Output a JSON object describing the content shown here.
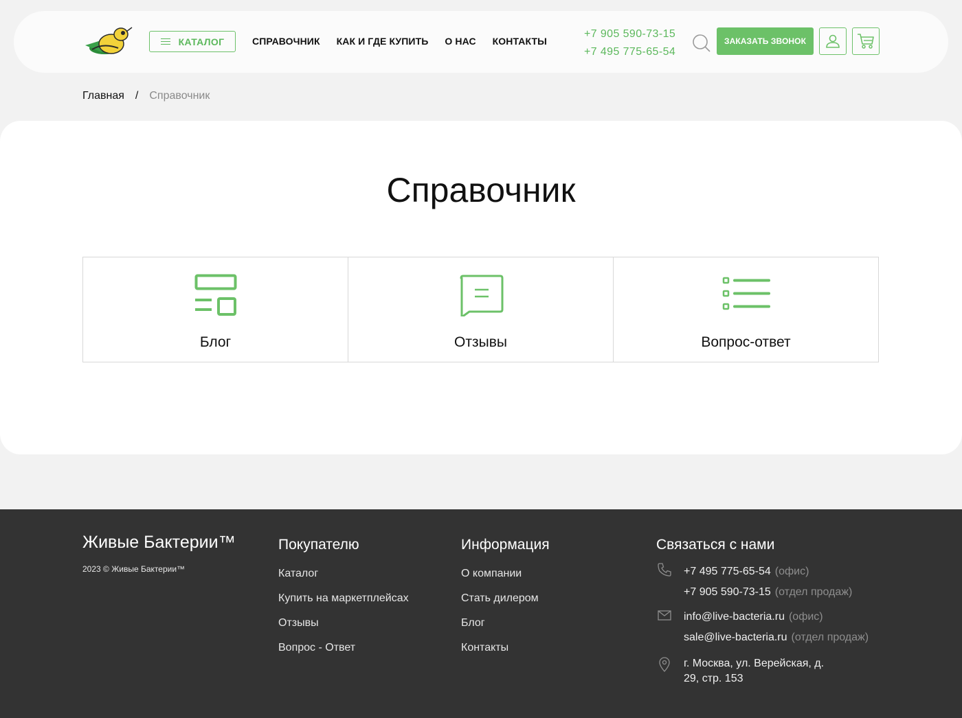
{
  "header": {
    "catalog_label": "КАТАЛОГ",
    "nav": [
      "СПРАВОЧНИК",
      "КАК И ГДЕ КУПИТЬ",
      "О НАС",
      "КОНТАКТЫ"
    ],
    "phones": [
      "+7 905 590-73-15",
      "+7 495 775-65-54"
    ],
    "order_call_label": "ЗАКАЗАТЬ ЗВОНОК",
    "icons": [
      "search-icon",
      "user-icon",
      "cart-icon"
    ],
    "accent_color": "#6cc168"
  },
  "breadcrumb": {
    "home": "Главная",
    "separator": "/",
    "current": "Справочник"
  },
  "main": {
    "title": "Справочник",
    "cards": [
      {
        "label": "Блог",
        "icon": "blog-layout-icon"
      },
      {
        "label": "Отзывы",
        "icon": "chat-bubble-icon"
      },
      {
        "label": "Вопрос-ответ",
        "icon": "list-icon"
      }
    ]
  },
  "footer": {
    "brand": "Живые Бактерии™",
    "copyright": "2023 © Живые Бактерии™",
    "buyer": {
      "heading": "Покупателю",
      "links": [
        "Каталог",
        "Купить на маркетплейсах",
        "Отзывы",
        "Вопрос - Ответ"
      ]
    },
    "info": {
      "heading": "Информация",
      "links": [
        "О компании",
        "Стать дилером",
        "Блог",
        "Контакты"
      ]
    },
    "contact": {
      "heading": "Связаться с нами",
      "phones": [
        {
          "value": "+7 495 775-65-54",
          "note": "(офис)"
        },
        {
          "value": "+7 905 590-73-15",
          "note": "(отдел продаж)"
        }
      ],
      "emails": [
        {
          "value": "info@live-bacteria.ru",
          "note": "(офис)"
        },
        {
          "value": "sale@live-bacteria.ru",
          "note": "(отдел продаж)"
        }
      ],
      "address": "г. Москва, ул. Верейская, д. 29, стр. 153"
    },
    "background_color": "#333333"
  }
}
